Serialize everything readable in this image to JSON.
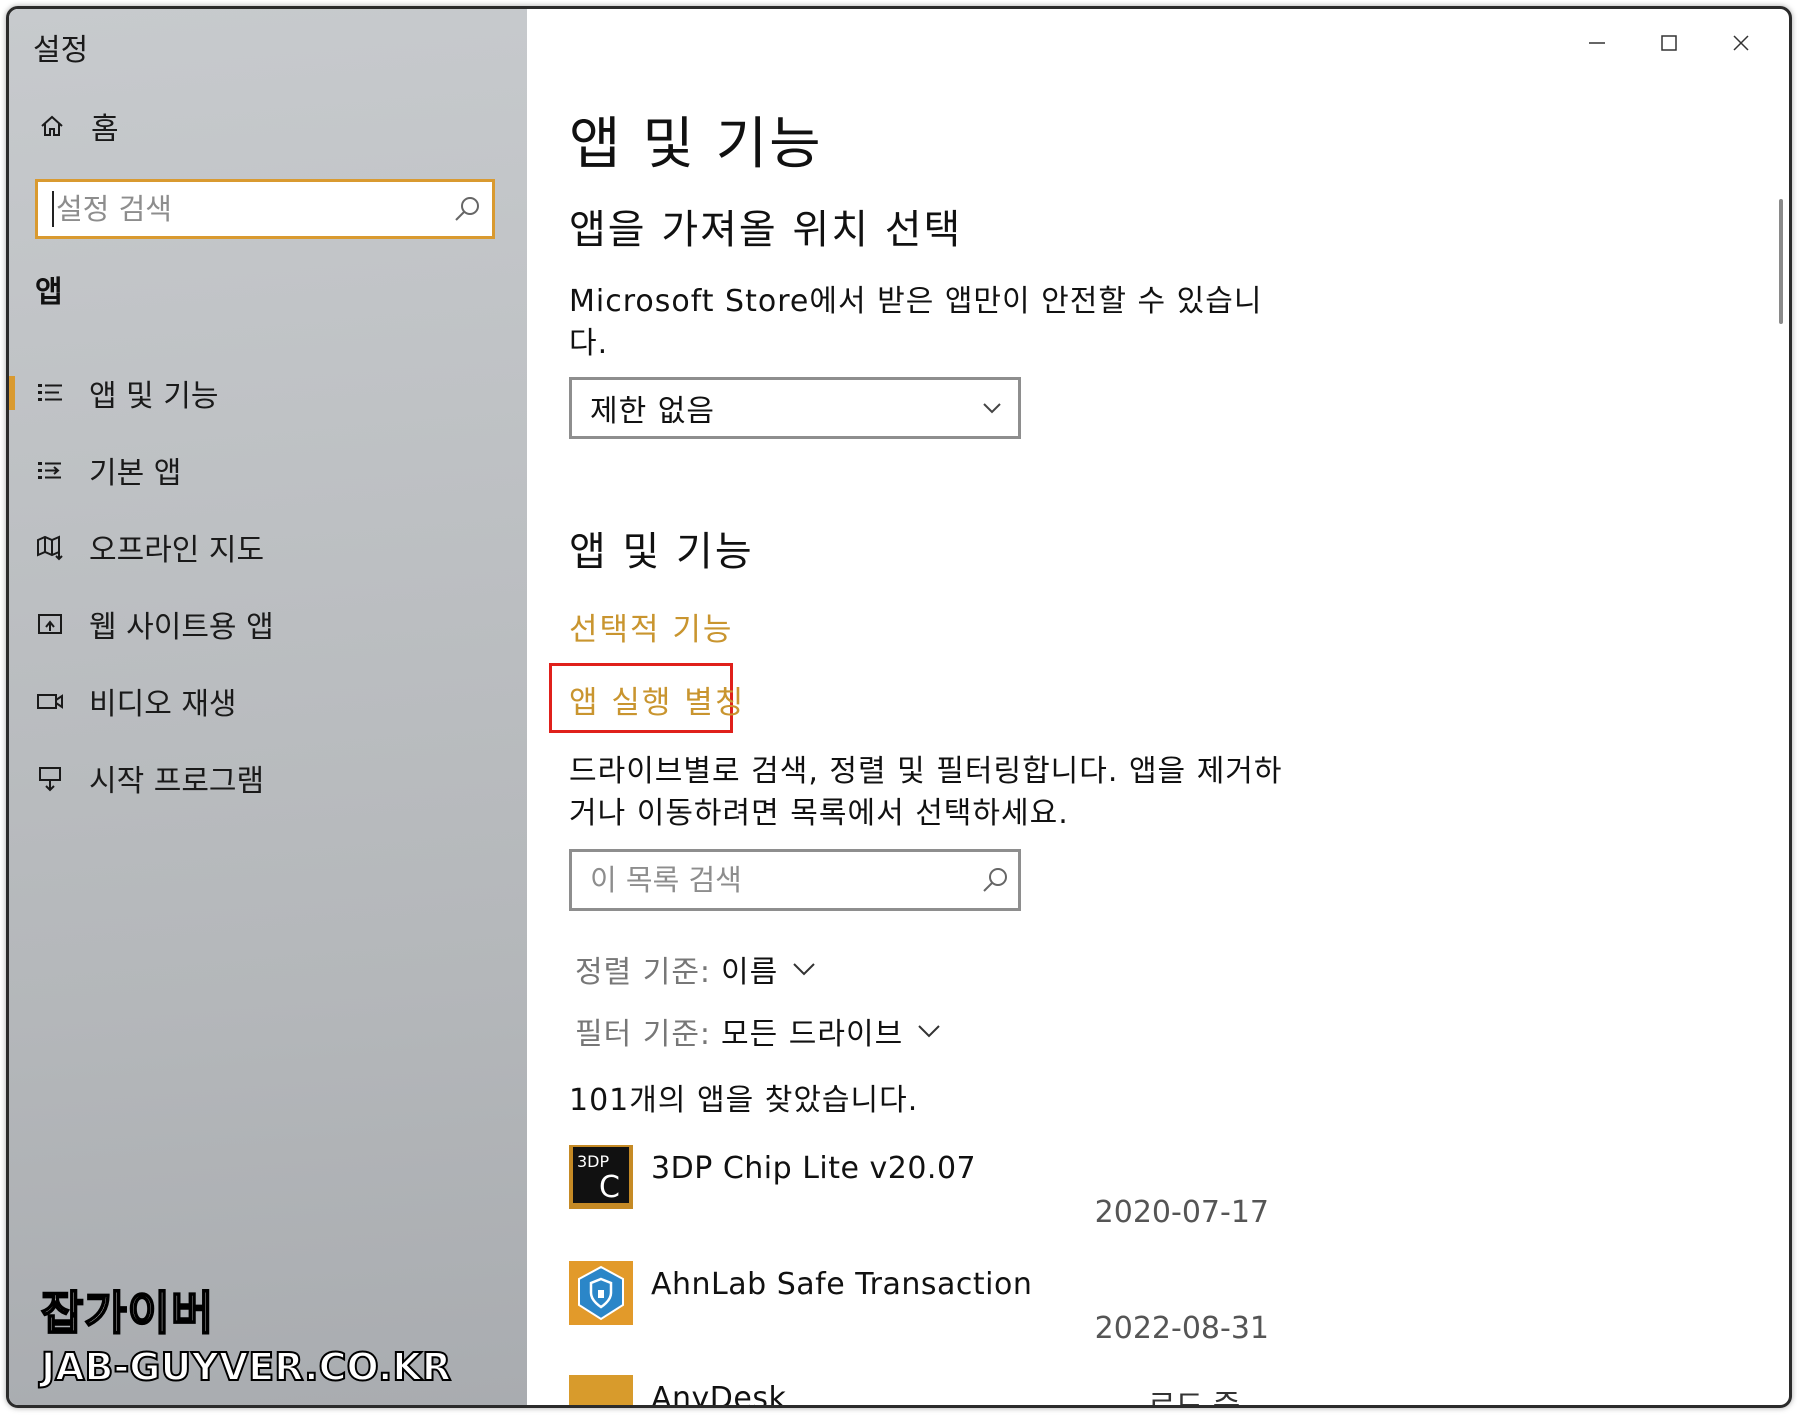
{
  "window": {
    "title": "설정"
  },
  "sidebar": {
    "home_label": "홈",
    "search_placeholder": "설정 검색",
    "section_title": "앱",
    "items": [
      {
        "label": "앱 및 기능",
        "icon": "apps-features-icon",
        "active": true
      },
      {
        "label": "기본 앱",
        "icon": "default-apps-icon",
        "active": false
      },
      {
        "label": "오프라인 지도",
        "icon": "offline-maps-icon",
        "active": false
      },
      {
        "label": "웹 사이트용 앱",
        "icon": "apps-for-websites-icon",
        "active": false
      },
      {
        "label": "비디오 재생",
        "icon": "video-playback-icon",
        "active": false
      },
      {
        "label": "시작 프로그램",
        "icon": "startup-icon",
        "active": false
      }
    ]
  },
  "watermark": {
    "line1": "잡가이버",
    "line2": "JAB-GUYVER.CO.KR"
  },
  "main": {
    "title": "앱 및 기능",
    "install_section": {
      "heading": "앱을 가져올 위치 선택",
      "description": "Microsoft Store에서 받은 앱만이 안전할 수 있습니다.",
      "dropdown_value": "제한 없음"
    },
    "apps_section": {
      "heading": "앱 및 기능",
      "link_optional_features": "선택적 기능",
      "link_app_execution_aliases": "앱 실행 별칭",
      "description": "드라이브별로 검색, 정렬 및 필터링합니다. 앱을 제거하거나 이동하려면 목록에서 선택하세요.",
      "search_placeholder": "이 목록 검색",
      "sort_label": "정렬 기준:",
      "sort_value": "이름",
      "filter_label": "필터 기준:",
      "filter_value": "모든 드라이브",
      "result_count": "101개의 앱을 찾았습니다."
    },
    "apps": [
      {
        "name": "3DP Chip Lite v20.07",
        "date": "2020-07-17",
        "icon": "3dp-chip-icon"
      },
      {
        "name": "AhnLab Safe Transaction",
        "date": "2022-08-31",
        "icon": "ahnlab-shield-icon"
      },
      {
        "name": "AnyDesk",
        "status": "로드 중...",
        "icon": "anydesk-icon"
      }
    ],
    "colors": {
      "accent": "#d99a30",
      "link": "#c9952f",
      "highlight_box": "#e0201b"
    }
  }
}
